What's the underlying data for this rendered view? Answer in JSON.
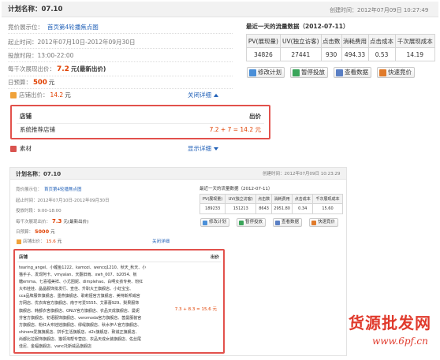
{
  "top": {
    "plan_title": "计划名称：07.10",
    "created": "创建时间：2012年07月09日 10:27:49",
    "position_label": "竟价展示位：",
    "position_value": "首页第4轮播焦点图",
    "period_label": "起止时间：2012年07月10日-2012年09月30日",
    "hours_label": "投放时段：13:00-22:00",
    "cpm_label": "每千次展现出价：",
    "cpm_value": "7.2",
    "cpm_suffix": "元(最新出价)",
    "budget_label": "日预算：",
    "budget_value": "500",
    "budget_unit": "元",
    "shop_bid_label": "店铺出价：",
    "shop_bid_value": "14.2",
    "shop_bid_unit": "元",
    "close_detail": "关闭详细",
    "shop_col": "店铺",
    "bid_col": "出价",
    "shop_row_name": "系统推荐店铺",
    "shop_row_value": "7.2 + 7 = 14.2 元",
    "material_label": "素材",
    "show_detail": "显示详细",
    "stats_title": "最近一天的流量数据（2012-07-11）",
    "stats_headers": [
      "PV(展现量)",
      "UV(独立访客)",
      "点击数",
      "消耗费用",
      "点击成本",
      "千次展现成本"
    ],
    "stats_values": [
      "34826",
      "27441",
      "930",
      "494.33",
      "0.53",
      "14.19"
    ],
    "buttons": [
      "修改计划",
      "暂停投放",
      "查看数据",
      "快速竟价"
    ]
  },
  "bottom": {
    "plan_title": "计划名称：07.10",
    "created": "创建时间：2012年07月09日 10:23:29",
    "position_label": "竟价展示位：",
    "position_value": "首页第4轮播焦点图",
    "period_label": "起止时间：2012年07月10日-2012年09月30日",
    "hours_label": "投放时段：9:00-18:00",
    "cpm_label": "每千次展现出价：",
    "cpm_value": "7.3",
    "cpm_suffix": "元(最新出价)",
    "budget_label": "日预算：",
    "budget_value": "5000",
    "budget_unit": "元",
    "shop_bid_label": "店铺出价：",
    "shop_bid_value": "15.6",
    "shop_bid_unit": "元",
    "close_detail": "关闭详细",
    "shop_col": "店铺",
    "bid_col": "出价",
    "shop_list": [
      "tearing_angel、小鲤鱼1222、kamozi、wencq1210、秋天_秋天、小",
      "猫手子、发现阿卡、vmyalan、天翻旧雨、xwh_007、b2054、板",
      "糖emma、七喜福美祥、小尤困妮、dimplehao、白啊女孩专卖、粉红",
      "大布娃娃、晶晶服饰批发行、查佳、升职大王旗舰店、小虹宝宝、",
      "cca品牌服饰旗舰店、墨燕旗舰店、歌莉娅官方旗舰店、美特斯邦威官",
      "方网店、优衣库官方旗舰店、南于可爱5555、艾慕蕾929、梨果服饰",
      "旗舰店、韩都衣舍旗舰店、ONLY官方旗舰店、衣品天成旗舰店、曼妮",
      "芬官方旗舰店、初语服饰旗舰店、veromoda官方旗舰店、茵曼服装官",
      "方旗舰店、粉红大布娃娃旗舰店、缪缇旗舰店、秋水伊人官方旗舰店、",
      "shinero爱旗旗舰店、拼手生活旗舰店、d2c旗舰店、致诚正旗舰店、",
      "尚都比拉服饰旗舰店、猫领淘帮专营店、衣品天成女装旗舰店、佐丝尾",
      "佳尼、金蝠旗舰店、vanc托斯威品旗舰店"
    ],
    "shop_list_value": "7.3 + 8.3 = 15.6 元",
    "stats_title": "最近一天的流量数据（2012-07-11）",
    "stats_headers": [
      "PV(展现量)",
      "UV(独立访客)",
      "点击数",
      "消耗费用",
      "点击成本",
      "千次展现成本"
    ],
    "stats_values": [
      "189233",
      "151213",
      "8643",
      "2951.80",
      "0.34",
      "15.60"
    ],
    "buttons": [
      "修改计划",
      "暂停投放",
      "查看数据",
      "快速竟价"
    ]
  },
  "watermark": {
    "title": "货源批发网",
    "url": "www.6pf.cn"
  },
  "colors": {
    "link": "#1f5fb7",
    "price": "#e04000",
    "highlight_border": "#e2514c"
  }
}
